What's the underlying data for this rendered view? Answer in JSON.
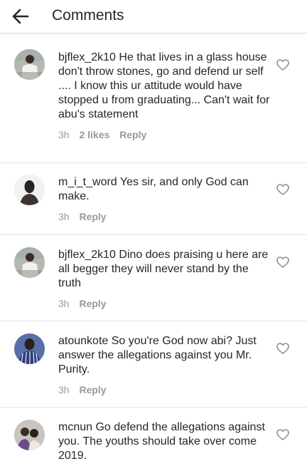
{
  "header": {
    "title": "Comments",
    "back_icon": "arrow-left-icon"
  },
  "comments": [
    {
      "username": "bjflex_2k10",
      "text": "He that lives in a glass house don't throw stones, go and defend ur self .... I know this ur attitude would have stopped u from graduating... Can't wait for abu's statement",
      "time": "3h",
      "likes": "2 likes",
      "reply": "Reply"
    },
    {
      "username": "m_i_t_word",
      "text": "Yes sir, and only God can make.",
      "time": "3h",
      "reply": "Reply"
    },
    {
      "username": "bjflex_2k10",
      "text": "Dino does praising u here are all begger they will never stand by the truth",
      "time": "3h",
      "reply": "Reply"
    },
    {
      "username": "atounkote",
      "text": "So you're God now abi? Just answer the allegations against you Mr. Purity.",
      "time": "3h",
      "reply": "Reply"
    },
    {
      "username": "mcnun",
      "text": "Go defend the allegations against you. The youths should take over come 2019."
    }
  ],
  "icons": {
    "like": "heart-outline-icon",
    "avatar": "user-avatar"
  },
  "colors": {
    "text": "#262626",
    "meta": "#999999",
    "divider": "#e6e6e6"
  }
}
